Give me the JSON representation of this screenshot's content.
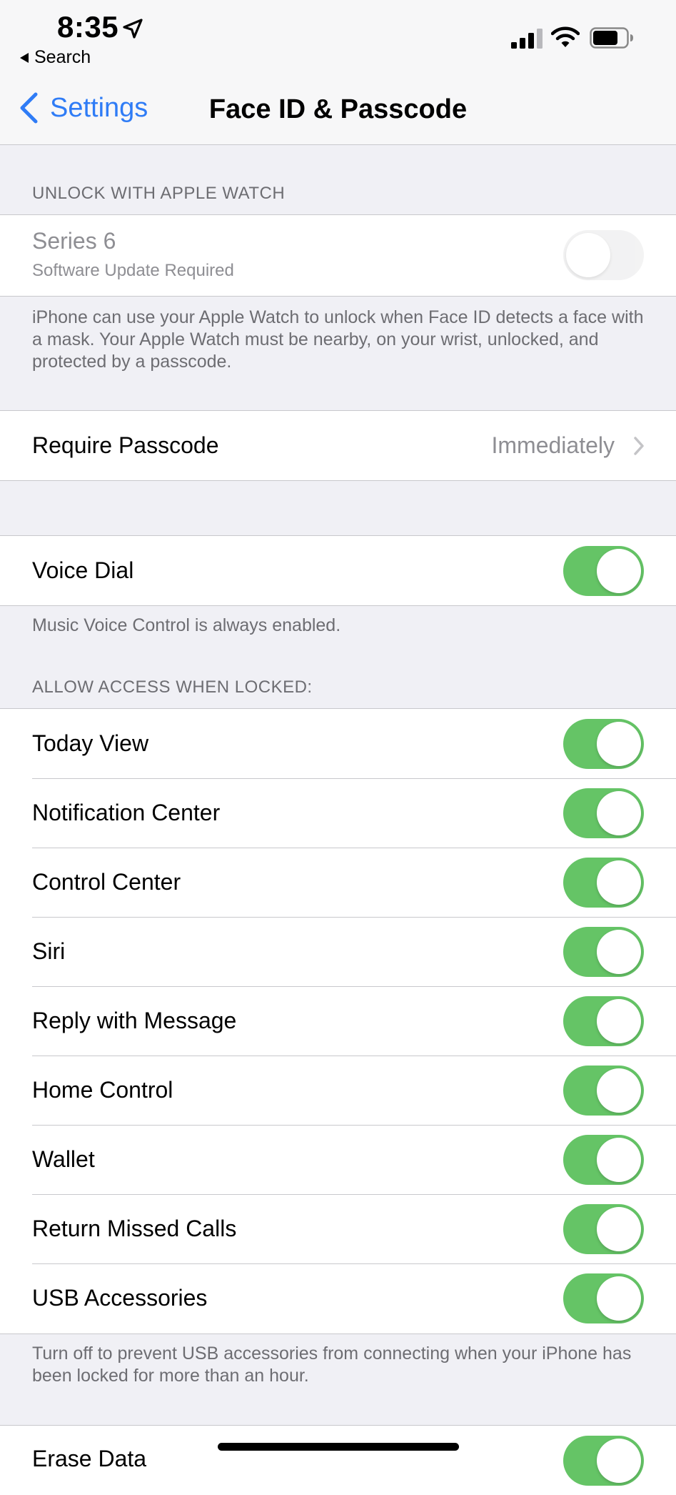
{
  "status_bar": {
    "time": "8:35",
    "back_app": "Search"
  },
  "nav": {
    "back_label": "Settings",
    "title": "Face ID & Passcode"
  },
  "apple_watch": {
    "header": "UNLOCK WITH APPLE WATCH",
    "device_name": "Series 6",
    "device_status": "Software Update Required",
    "toggle_on": false,
    "footer": "iPhone can use your Apple Watch to unlock when Face ID detects a face with a mask. Your Apple Watch must be nearby, on your wrist, unlocked, and protected by a passcode."
  },
  "require_passcode": {
    "label": "Require Passcode",
    "value": "Immediately"
  },
  "voice_dial": {
    "label": "Voice Dial",
    "toggle_on": true,
    "footer": "Music Voice Control is always enabled."
  },
  "locked_access": {
    "header": "ALLOW ACCESS WHEN LOCKED:",
    "items": [
      {
        "label": "Today View",
        "on": true
      },
      {
        "label": "Notification Center",
        "on": true
      },
      {
        "label": "Control Center",
        "on": true
      },
      {
        "label": "Siri",
        "on": true
      },
      {
        "label": "Reply with Message",
        "on": true
      },
      {
        "label": "Home Control",
        "on": true
      },
      {
        "label": "Wallet",
        "on": true
      },
      {
        "label": "Return Missed Calls",
        "on": true
      },
      {
        "label": "USB Accessories",
        "on": true
      }
    ],
    "footer": "Turn off to prevent USB accessories from connecting when your iPhone has been locked for more than an hour."
  },
  "erase_data": {
    "label": "Erase Data",
    "toggle_on": true
  },
  "colors": {
    "accent": "#2f7cf6",
    "toggle_on": "#65c466",
    "background": "#f0f0f5"
  }
}
